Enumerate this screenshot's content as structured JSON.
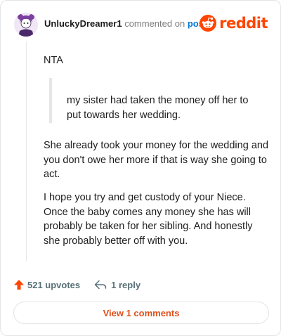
{
  "header": {
    "username": "UnluckyDreamer1",
    "action_text": "commented on",
    "post_link": "post",
    "logo_text": "reddit"
  },
  "comment": {
    "line1": "NTA",
    "quote": "my sister had taken the money off her to put towards her wedding.",
    "paragraph2": "She already took your money for the wedding and you don't owe her more if that is way she going to act.",
    "paragraph3": "I hope you try and get custody of your Niece. Once the baby comes any money she has will probably be taken for her sibling. And honestly she probably better off with you."
  },
  "footer": {
    "upvotes_label": "521 upvotes",
    "replies_label": "1 reply",
    "view_comments_label": "View 1 comments"
  },
  "colors": {
    "accent": "#ff4500",
    "link": "#0079d3",
    "view_comments": "#e0501b"
  }
}
